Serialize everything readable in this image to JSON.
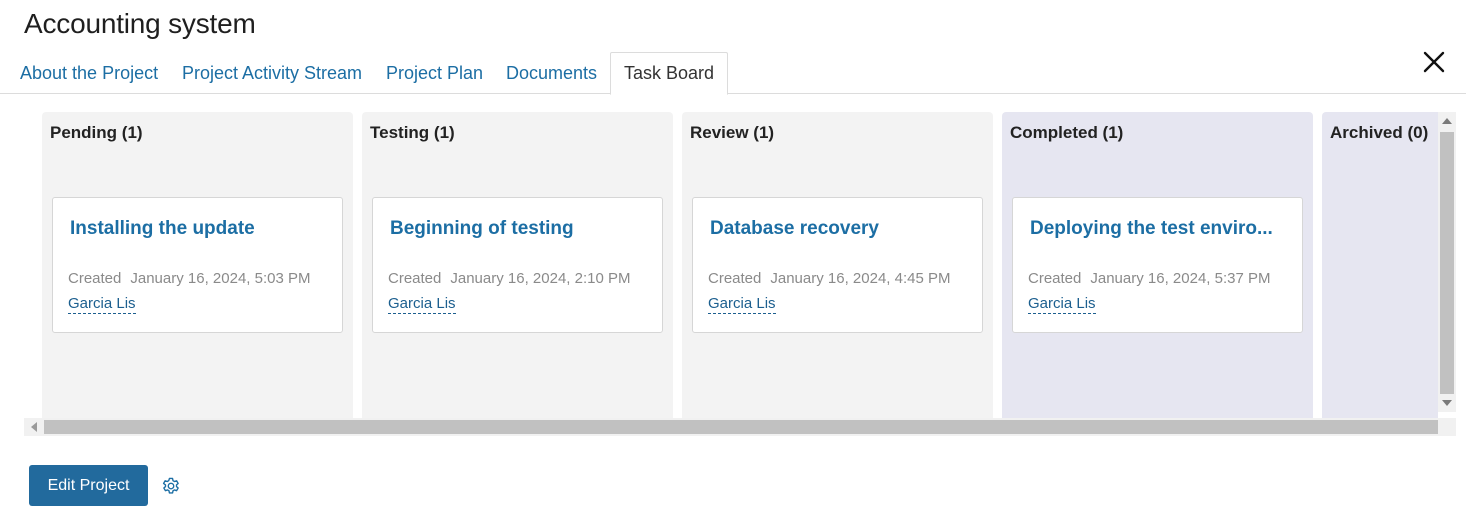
{
  "header": {
    "title": "Accounting system"
  },
  "tabs": [
    {
      "label": "About the Project",
      "active": false
    },
    {
      "label": "Project Activity Stream",
      "active": false
    },
    {
      "label": "Project Plan",
      "active": false
    },
    {
      "label": "Documents",
      "active": false
    },
    {
      "label": "Task Board",
      "active": true
    }
  ],
  "board": {
    "columns": [
      {
        "header": "Pending (1)",
        "card": {
          "title": "Installing the update",
          "created_label": "Created",
          "created_date": "January 16, 2024, 5:03 PM",
          "author": "Garcia Lis"
        }
      },
      {
        "header": "Testing (1)",
        "card": {
          "title": "Beginning of testing",
          "created_label": "Created",
          "created_date": "January 16, 2024, 2:10 PM",
          "author": "Garcia Lis"
        }
      },
      {
        "header": "Review (1)",
        "card": {
          "title": "Database recovery",
          "created_label": "Created",
          "created_date": "January 16, 2024, 4:45 PM",
          "author": "Garcia Lis"
        }
      },
      {
        "header": "Completed (1)",
        "card": {
          "title": "Deploying the test enviro...",
          "created_label": "Created",
          "created_date": "January 16, 2024, 5:37 PM",
          "author": "Garcia Lis"
        }
      },
      {
        "header": "Archived (0)"
      }
    ]
  },
  "footer": {
    "edit_label": "Edit Project"
  },
  "icons": {
    "close": "close-icon",
    "settings": "gear-icon"
  },
  "colors": {
    "link": "#1c6ea4",
    "primary_button": "#226a9d",
    "column_bg": "#f3f3f3",
    "column_done_bg": "#e6e6f1"
  }
}
